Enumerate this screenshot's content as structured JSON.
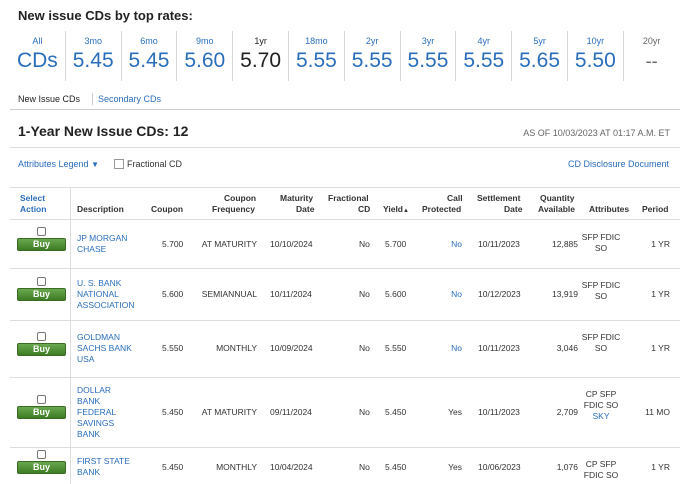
{
  "header": {
    "title": "New issue CDs by top rates:"
  },
  "rates": [
    {
      "term": "All",
      "value": "CDs"
    },
    {
      "term": "3mo",
      "value": "5.45"
    },
    {
      "term": "6mo",
      "value": "5.45"
    },
    {
      "term": "9mo",
      "value": "5.60"
    },
    {
      "term": "1yr",
      "value": "5.70"
    },
    {
      "term": "18mo",
      "value": "5.55"
    },
    {
      "term": "2yr",
      "value": "5.55"
    },
    {
      "term": "3yr",
      "value": "5.55"
    },
    {
      "term": "4yr",
      "value": "5.55"
    },
    {
      "term": "5yr",
      "value": "5.65"
    },
    {
      "term": "10yr",
      "value": "5.50"
    },
    {
      "term": "20yr",
      "value": "--"
    }
  ],
  "tabs": {
    "active": "New Issue CDs",
    "other": "Secondary CDs"
  },
  "section": {
    "title": "1-Year New Issue CDs: 12",
    "as_of": "AS OF 10/03/2023 AT 01:17 A.M. ET",
    "legend": "Attributes Legend",
    "legend_caret": "▼",
    "fractional": "Fractional CD",
    "doc_link": "CD Disclosure Document"
  },
  "columns": {
    "select_1": "Select",
    "select_2": "Action",
    "description": "Description",
    "coupon": "Coupon",
    "freq_1": "Coupon",
    "freq_2": "Frequency",
    "maturity_1": "Maturity",
    "maturity_2": "Date",
    "fractional_1": "Fractional",
    "fractional_2": "CD",
    "yield": "Yield",
    "yield_sort": "▲",
    "call_1": "Call",
    "call_2": "Protected",
    "settle_1": "Settlement",
    "settle_2": "Date",
    "qty_1": "Quantity",
    "qty_2": "Available",
    "attributes": "Attributes",
    "period": "Period"
  },
  "buy_label": "Buy",
  "rows": [
    {
      "desc": [
        "JP MORGAN",
        "CHASE"
      ],
      "coupon": "5.700",
      "freq": "AT MATURITY",
      "maturity": "10/10/2024",
      "fractional": "No",
      "yield": "5.700",
      "call": "No",
      "settle": "10/11/2023",
      "qty": "12,885",
      "attr": [
        "SFP FDIC",
        "SO"
      ],
      "period": "1 YR"
    },
    {
      "desc": [
        "U. S. BANK",
        "NATIONAL",
        "ASSOCIATION"
      ],
      "coupon": "5.600",
      "freq": "SEMIANNUAL",
      "maturity": "10/11/2024",
      "fractional": "No",
      "yield": "5.600",
      "call": "No",
      "settle": "10/12/2023",
      "qty": "13,919",
      "attr": [
        "SFP FDIC",
        "SO"
      ],
      "period": "1 YR"
    },
    {
      "desc": [
        "GOLDMAN",
        "SACHS BANK",
        "USA"
      ],
      "coupon": "5.550",
      "freq": "MONTHLY",
      "maturity": "10/09/2024",
      "fractional": "No",
      "yield": "5.550",
      "call": "No",
      "settle": "10/11/2023",
      "qty": "3,046",
      "attr": [
        "SFP FDIC",
        "SO"
      ],
      "period": "1 YR"
    },
    {
      "desc": [
        "DOLLAR",
        "BANK",
        "FEDERAL",
        "SAVINGS",
        "BANK"
      ],
      "coupon": "5.450",
      "freq": "AT MATURITY",
      "maturity": "09/11/2024",
      "fractional": "No",
      "yield": "5.450",
      "call": "Yes",
      "settle": "10/11/2023",
      "qty": "2,709",
      "attr": [
        "CP SFP",
        "FDIC SO",
        "SKY"
      ],
      "period": "11 MO"
    },
    {
      "desc": [
        "FIRST STATE",
        "BANK"
      ],
      "coupon": "5.450",
      "freq": "MONTHLY",
      "maturity": "10/04/2024",
      "fractional": "No",
      "yield": "5.450",
      "call": "Yes",
      "settle": "10/06/2023",
      "qty": "1,076",
      "attr": [
        "CP SFP",
        "FDIC SO"
      ],
      "period": "1 YR"
    }
  ]
}
